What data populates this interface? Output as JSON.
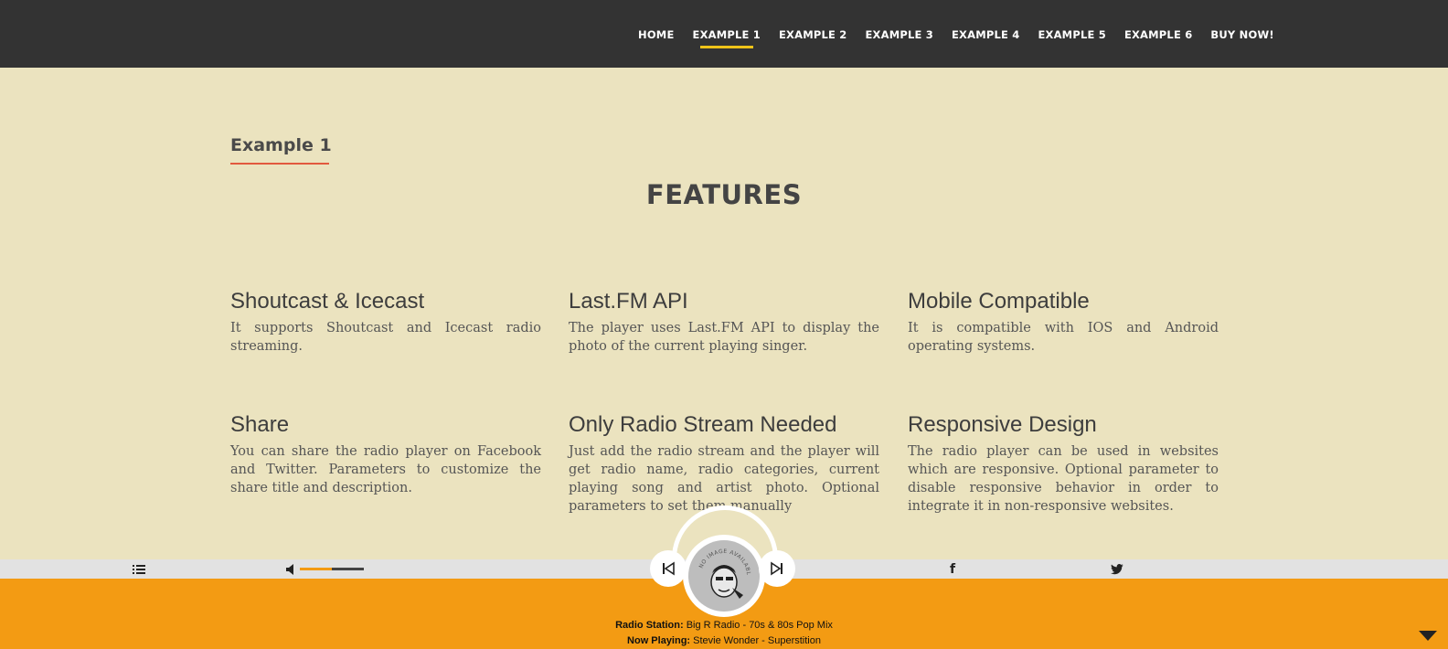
{
  "nav": {
    "items": [
      {
        "label": "HOME"
      },
      {
        "label": "EXAMPLE 1"
      },
      {
        "label": "EXAMPLE 2"
      },
      {
        "label": "EXAMPLE 3"
      },
      {
        "label": "EXAMPLE 4"
      },
      {
        "label": "EXAMPLE 5"
      },
      {
        "label": "EXAMPLE 6"
      },
      {
        "label": "BUY NOW!"
      }
    ],
    "active_index": 1,
    "active_underline_color": "#f0c419"
  },
  "page": {
    "heading": "Example 1",
    "section_title": "FEATURES"
  },
  "features": [
    {
      "title": "Shoutcast & Icecast",
      "text": "It supports Shoutcast and Icecast radio streaming."
    },
    {
      "title": "Last.FM API",
      "text": "The player uses Last.FM API to display the photo of the current playing singer."
    },
    {
      "title": "Mobile Compatible",
      "text": "It is compatible with IOS and Android operating systems."
    },
    {
      "title": "Share",
      "text": "You can share the radio player on Facebook and Twitter. Parameters to customize the share title and description."
    },
    {
      "title": "Only Radio Stream Needed",
      "text": "Just add the radio stream and the player will get radio name, radio categories, current playing song and artist photo. Optional parameters to set them manually"
    },
    {
      "title": "Responsive Design",
      "text": "The radio player can be used in websites which are responsive. Optional parameter to disable responsive behavior in order to integrate it in non-responsive websites."
    }
  ],
  "player": {
    "station_label": "Radio Station:",
    "station_name": "Big R Radio - 70s & 80s Pop Mix",
    "now_playing_label": "Now Playing:",
    "now_playing": "Stevie Wonder - Superstition",
    "album_art_text": "NO IMAGE AVAILABLE",
    "volume_level": 0.5,
    "colors": {
      "bar": "#f39b13",
      "strip": "#e2e2e2"
    },
    "icons": {
      "playlist": "playlist-icon",
      "volume": "volume-icon",
      "prev": "skip-back-icon",
      "next": "skip-forward-icon",
      "facebook": "facebook-icon",
      "twitter": "twitter-icon",
      "collapse": "chevron-down-icon"
    }
  },
  "colors": {
    "nav_bg": "#333333",
    "page_bg": "#ebe3bf",
    "heading_underline": "#e2593e"
  }
}
